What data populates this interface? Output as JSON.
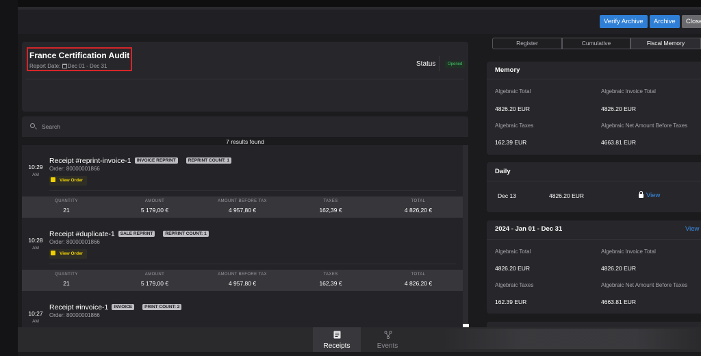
{
  "header": {
    "verify_archive": "Verify Archive",
    "archive": "Archive",
    "close": "Close",
    "colors": {
      "primary": "#2f7fd6",
      "secondary": "#6a6a6e"
    }
  },
  "audit": {
    "title": "France Certification Audit",
    "date_label": "Report Date:",
    "date_range": "Dec 01 - Dec 31",
    "status_label": "Status",
    "status_value": "Opened",
    "status_color": "#4bc26b"
  },
  "search": {
    "placeholder": "Search"
  },
  "results_text": "7 results found",
  "stats_headers": {
    "quantity": "QUANTITY",
    "amount": "AMOUNT",
    "amount_before_tax": "AMOUNT BEFORE TAX",
    "taxes": "TAXES",
    "total": "TOTAL"
  },
  "receipts": [
    {
      "time": "10:29",
      "ampm": "AM",
      "title": "Receipt #reprint-invoice-1",
      "badge1": "INVOICE REPRINT",
      "badge2": "REPRINT COUNT: 1",
      "order": "Order: 80000001866",
      "view_label": "View Order",
      "quantity": "21",
      "amount": "5 179,00 €",
      "amount_before_tax": "4 957,80 €",
      "taxes": "162,39 €",
      "total": "4 826,20 €"
    },
    {
      "time": "10:28",
      "ampm": "AM",
      "title": "Receipt #duplicate-1",
      "badge1": "SALE REPRINT",
      "badge2": "REPRINT COUNT: 1",
      "order": "Order: 80000001866",
      "view_label": "View Order",
      "quantity": "21",
      "amount": "5 179,00 €",
      "amount_before_tax": "4 957,80 €",
      "taxes": "162,39 €",
      "total": "4 826,20 €"
    },
    {
      "time": "10:27",
      "ampm": "AM",
      "title": "Receipt #invoice-1",
      "badge1": "INVOICE",
      "badge2": "PRINT COUNT: 2",
      "order": "Order: 80000001866"
    }
  ],
  "tabs": {
    "register": "Register",
    "cumulative": "Cumulative",
    "fiscal_memory": "Fiscal Memory"
  },
  "memory": {
    "title": "Memory",
    "alg_total_label": "Algebraic Total",
    "alg_total": "4826.20 EUR",
    "alg_invoice_total_label": "Algebraic Invoice Total",
    "alg_invoice_total": "4826.20 EUR",
    "alg_taxes_label": "Algebraic Taxes",
    "alg_taxes": "162.39 EUR",
    "alg_net_label": "Algebraic Net Amount Before Taxes",
    "alg_net": "4663.81 EUR"
  },
  "daily": {
    "title": "Daily",
    "date": "Dec 13",
    "amount": "4826.20 EUR",
    "view": "View"
  },
  "yearly": {
    "title": "2024 - Jan 01 - Dec 31",
    "view": "View",
    "alg_total_label": "Algebraic Total",
    "alg_total": "4826.20 EUR",
    "alg_invoice_total_label": "Algebraic Invoice Total",
    "alg_invoice_total": "4826.20 EUR",
    "alg_taxes_label": "Algebraic Taxes",
    "alg_taxes": "162.39 EUR",
    "alg_net_label": "Algebraic Net Amount Before Taxes",
    "alg_net": "4663.81 EUR"
  },
  "nav": {
    "receipts": "Receipts",
    "events": "Events"
  },
  "icons": [
    "calendar-icon",
    "search-icon",
    "view-order-icon",
    "lock-icon",
    "receipts-icon",
    "events-icon"
  ]
}
